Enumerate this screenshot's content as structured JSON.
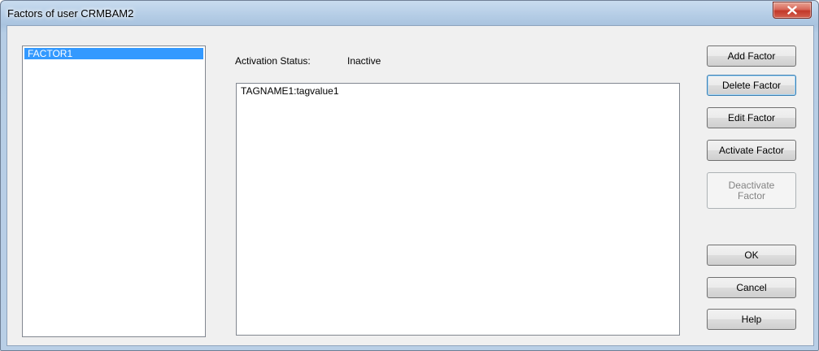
{
  "window": {
    "title": "Factors of user CRMBAM2",
    "close_icon": "close-icon"
  },
  "factors": {
    "items": [
      {
        "label": "FACTOR1",
        "selected": true
      }
    ]
  },
  "status": {
    "label": "Activation Status:",
    "value": "Inactive"
  },
  "tags": {
    "lines": [
      "TAGNAME1:tagvalue1"
    ]
  },
  "buttons": {
    "add_factor": "Add Factor",
    "delete_factor": "Delete Factor",
    "edit_factor": "Edit Factor",
    "activate_factor": "Activate Factor",
    "deactivate_factor_line1": "Deactivate",
    "deactivate_factor_line2": "Factor",
    "ok": "OK",
    "cancel": "Cancel",
    "help": "Help"
  },
  "colors": {
    "selection": "#3399ff",
    "close_button": "#c2382a",
    "frame": "#b9cfe6"
  }
}
